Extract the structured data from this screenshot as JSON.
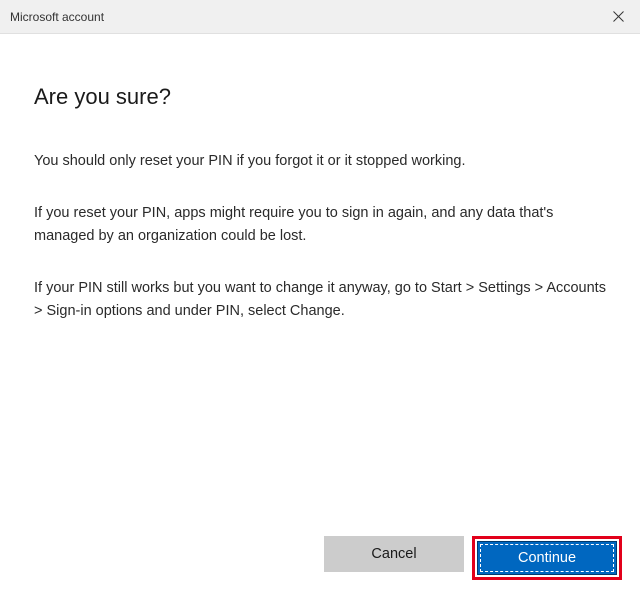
{
  "titlebar": {
    "title": "Microsoft account"
  },
  "dialog": {
    "heading": "Are you sure?",
    "para1": "You should only reset your PIN if you forgot it or it stopped working.",
    "para2": "If you reset your PIN, apps might require you to sign in again, and any data that's managed by an organization could be lost.",
    "para3": "If your PIN still works but you want to change it anyway, go to Start > Settings > Accounts > Sign-in options and under PIN, select Change."
  },
  "buttons": {
    "cancel": "Cancel",
    "continue": "Continue"
  }
}
